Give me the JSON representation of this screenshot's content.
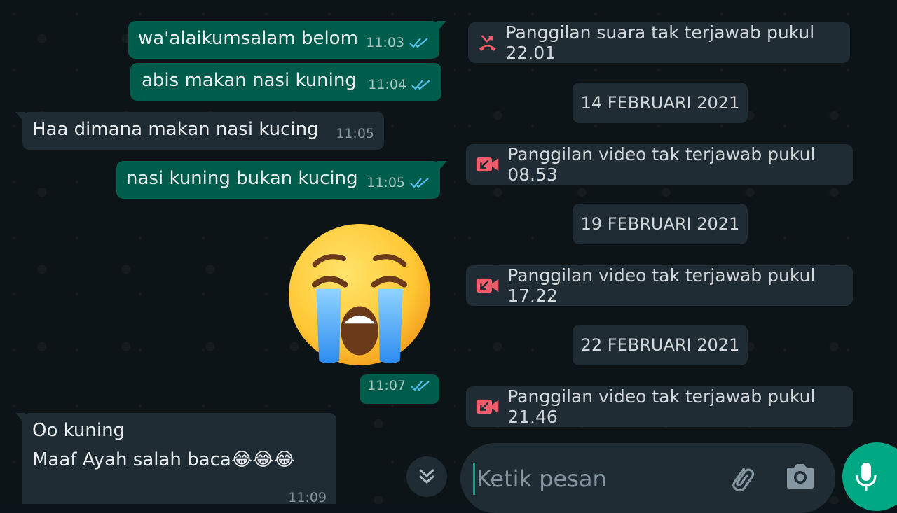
{
  "left": {
    "messages": [
      {
        "type": "out",
        "text": "wa'alaikumsalam belom",
        "time": "11:03"
      },
      {
        "type": "out",
        "text": "abis makan nasi kuning",
        "time": "11:04"
      },
      {
        "type": "in",
        "text": "Haa dimana makan nasi kucing",
        "time": "11:05"
      },
      {
        "type": "out",
        "text": "nasi kuning bukan kucing",
        "time": "11:05"
      },
      {
        "type": "out",
        "emoji": "loudly-crying-face",
        "time": "11:07"
      },
      {
        "type": "in",
        "line1": "Oo kuning",
        "line2": "Maaf Ayah salah baca",
        "emojis": "😂😂😂",
        "time": "11:09"
      }
    ],
    "scroll_icon": "double-chevron-down-icon"
  },
  "right": {
    "items": [
      {
        "kind": "call",
        "icon": "missed-voice-call-icon",
        "text": "Panggilan suara tak terjawab pukul 22.01"
      },
      {
        "kind": "date",
        "text": "14 FEBRUARI 2021"
      },
      {
        "kind": "call",
        "icon": "missed-video-call-icon",
        "text": "Panggilan video tak terjawab pukul 08.53"
      },
      {
        "kind": "date",
        "text": "19 FEBRUARI 2021"
      },
      {
        "kind": "call",
        "icon": "missed-video-call-icon",
        "text": "Panggilan video tak terjawab pukul 17.22"
      },
      {
        "kind": "date",
        "text": "22 FEBRUARI 2021"
      },
      {
        "kind": "call",
        "icon": "missed-video-call-icon",
        "text": "Panggilan video tak terjawab pukul 21.46"
      }
    ],
    "compose": {
      "placeholder": "Ketik pesan"
    },
    "icons": {
      "attach": "paperclip-icon",
      "camera": "camera-icon",
      "mic": "microphone-icon"
    }
  },
  "colors": {
    "outgoing_bubble": "#005c4b",
    "incoming_bubble": "#202c33",
    "read_ticks": "#53bdeb",
    "missed_call": "#f15c6d",
    "accent": "#00a884"
  }
}
